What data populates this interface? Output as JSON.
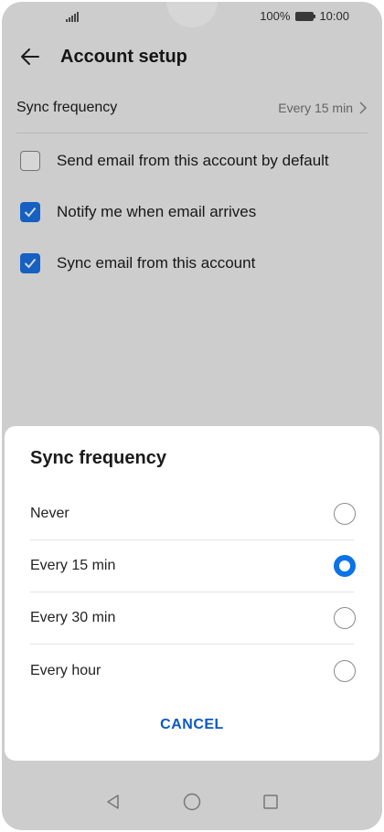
{
  "status_bar": {
    "battery_percent": "100%",
    "time": "10:00"
  },
  "app_bar": {
    "title": "Account setup",
    "back_icon": "arrow-left-icon"
  },
  "settings": {
    "sync_frequency": {
      "label": "Sync frequency",
      "value": "Every 15 min"
    },
    "checkboxes": [
      {
        "label": "Send email from this account by default",
        "checked": false
      },
      {
        "label": "Notify me when email arrives",
        "checked": true
      },
      {
        "label": "Sync email from this account",
        "checked": true
      }
    ]
  },
  "dialog": {
    "title": "Sync frequency",
    "options": [
      {
        "label": "Never",
        "selected": false
      },
      {
        "label": "Every 15 min",
        "selected": true
      },
      {
        "label": "Every 30 min",
        "selected": false
      },
      {
        "label": "Every hour",
        "selected": false
      }
    ],
    "cancel_label": "CANCEL"
  },
  "colors": {
    "accent": "#1a73e8",
    "cancel_text": "#0a59c2"
  },
  "nav_bar": {
    "icons": [
      "back-triangle-icon",
      "home-circle-icon",
      "recents-square-icon"
    ]
  }
}
